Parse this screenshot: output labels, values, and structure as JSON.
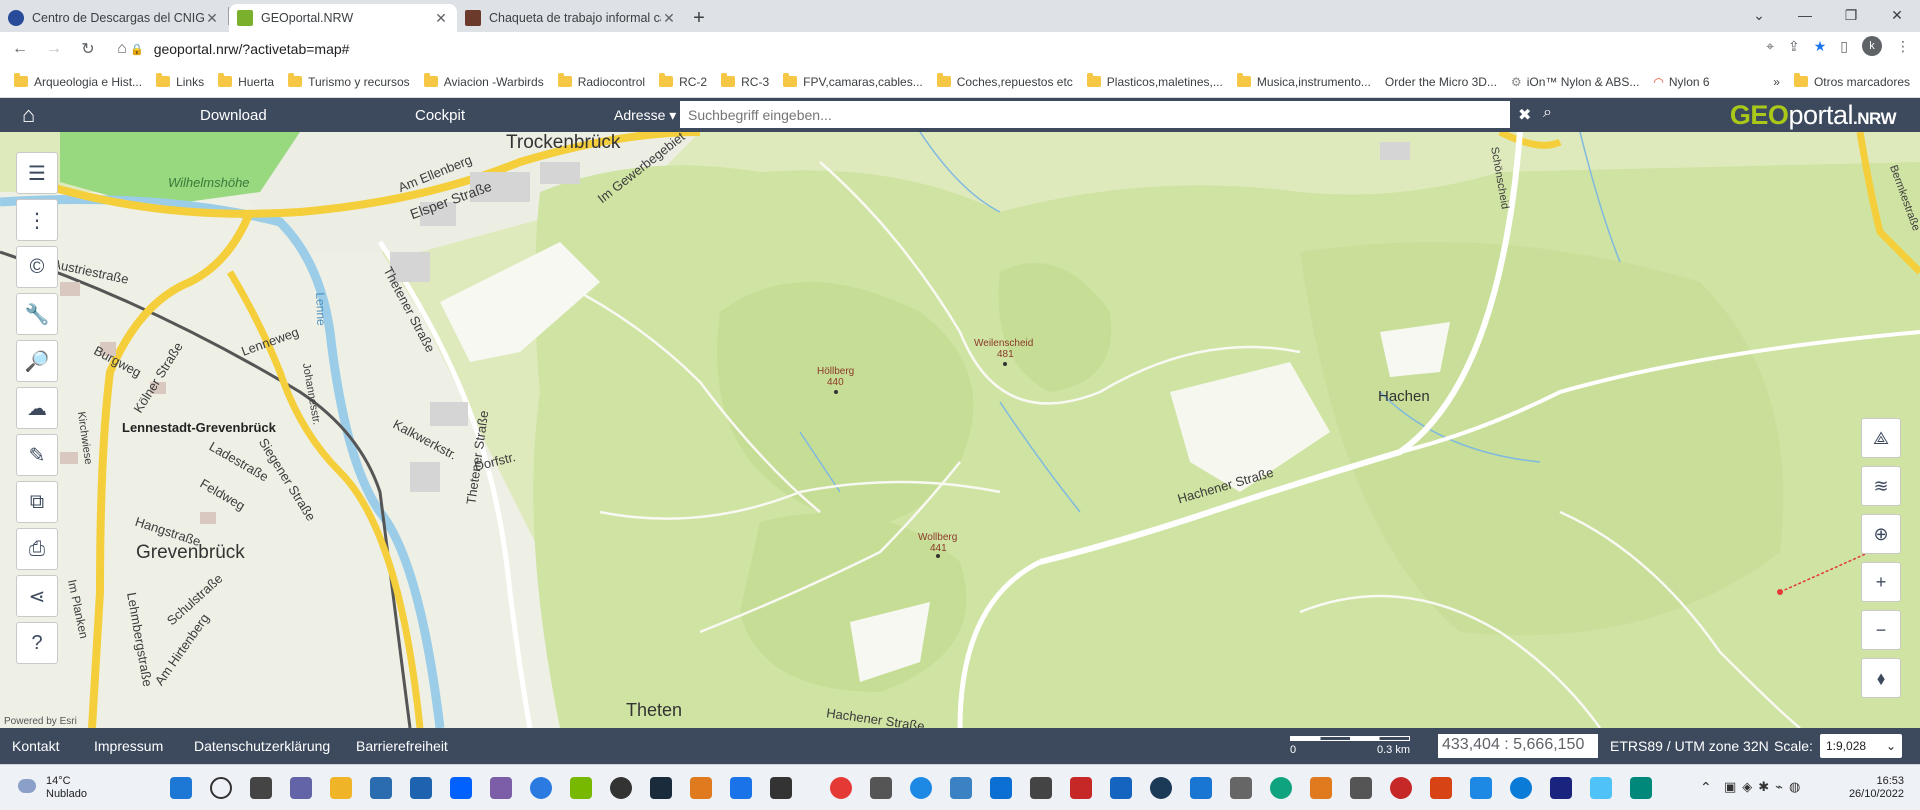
{
  "browser": {
    "tabs": [
      {
        "title": "Centro de Descargas del CNIG (IG",
        "favicon_color": "#2a4a9a"
      },
      {
        "title": "GEOportal.NRW",
        "favicon_color": "#7ab02c"
      },
      {
        "title": "Chaqueta de trabajo informal cá",
        "favicon_color": "#6b3a2a"
      }
    ],
    "url": "geoportal.nrw/?activetab=map#",
    "profile_initial": "k",
    "bookmarks": [
      "Arqueologia e Hist...",
      "Links",
      "Huerta",
      "Turismo y recursos",
      "Aviacion -Warbirds",
      "Radiocontrol",
      "RC-2",
      "RC-3",
      "FPV,camaras,cables...",
      "Coches,repuestos etc",
      "Plasticos,maletines,...",
      "Musica,instrumento...",
      "Order the Micro 3D...",
      "iOn™ Nylon & ABS...",
      "Nylon 6"
    ],
    "bookmarks_overflow": "»",
    "other_bookmarks": "Otros marcadores"
  },
  "geoportal": {
    "nav": {
      "download": "Download",
      "cockpit": "Cockpit",
      "adresse": "Adresse ▾"
    },
    "search_placeholder": "Suchbegriff eingeben...",
    "brand": {
      "geo": "GEO",
      "portal": "portal",
      "nrw": ".NRW"
    },
    "powered_by": "Powered by Esri"
  },
  "map_labels": {
    "trockenbruck": "Trockenbrück",
    "ellenberg": "Am Ellenberg",
    "elsper": "Elsper Straße",
    "gewerbegebiet": "Im Gewerbegebiet",
    "wilhelmshohe": "Wilhelmshöhe",
    "austria": "Austriestraße",
    "burgweg": "Burgweg",
    "kolner": "Kölner Straße",
    "lenneweg": "Lenneweg",
    "station": "Lennestadt-Grevenbrück",
    "siegener": "Siegener Straße",
    "johannes": "Johannesstr.",
    "ladestr": "Ladestraße",
    "feldweg": "Feldweg",
    "hangstr": "Hangstraße",
    "grevenbruck": "Grevenbrück",
    "schulstr": "Schulstraße",
    "hirtenberg": "Am Hirtenberg",
    "lehmberg": "Lehmbergstraße",
    "thetener1": "Thetener Straße",
    "thetener2": "Thetener Straße",
    "kalkwerk": "Kalkwerkstr.",
    "dorfstr": "Dorfstr.",
    "theten": "Theten",
    "hollberg": "Höllberg",
    "hollberg_h": "440",
    "weilenscheid": "Weilenscheid",
    "weilenscheid_h": "481",
    "wollberg": "Wollberg",
    "wollberg_h": "441",
    "hachen": "Hachen",
    "hachener": "Hachener Straße",
    "hachener2": "Hachener Straße",
    "schonscheid": "Schönscheid",
    "bermke": "Bermkestraße",
    "kirchwiese": "Kirchwiese",
    "planken": "Im Planken",
    "lenne": "Lenne"
  },
  "footer": {
    "links": [
      "Kontakt",
      "Impressum",
      "Datenschutzerklärung",
      "Barrierefreiheit"
    ],
    "scale_0": "0",
    "scale_km": "0.3 km",
    "coords": "433,404 : 5,666,150",
    "crs": "ETRS89 / UTM zone 32N",
    "scale_label": "Scale:",
    "scale_value": "1:9,028"
  },
  "taskbar": {
    "temp": "14°C",
    "weather": "Nublado",
    "time": "16:53",
    "date": "26/10/2022"
  }
}
